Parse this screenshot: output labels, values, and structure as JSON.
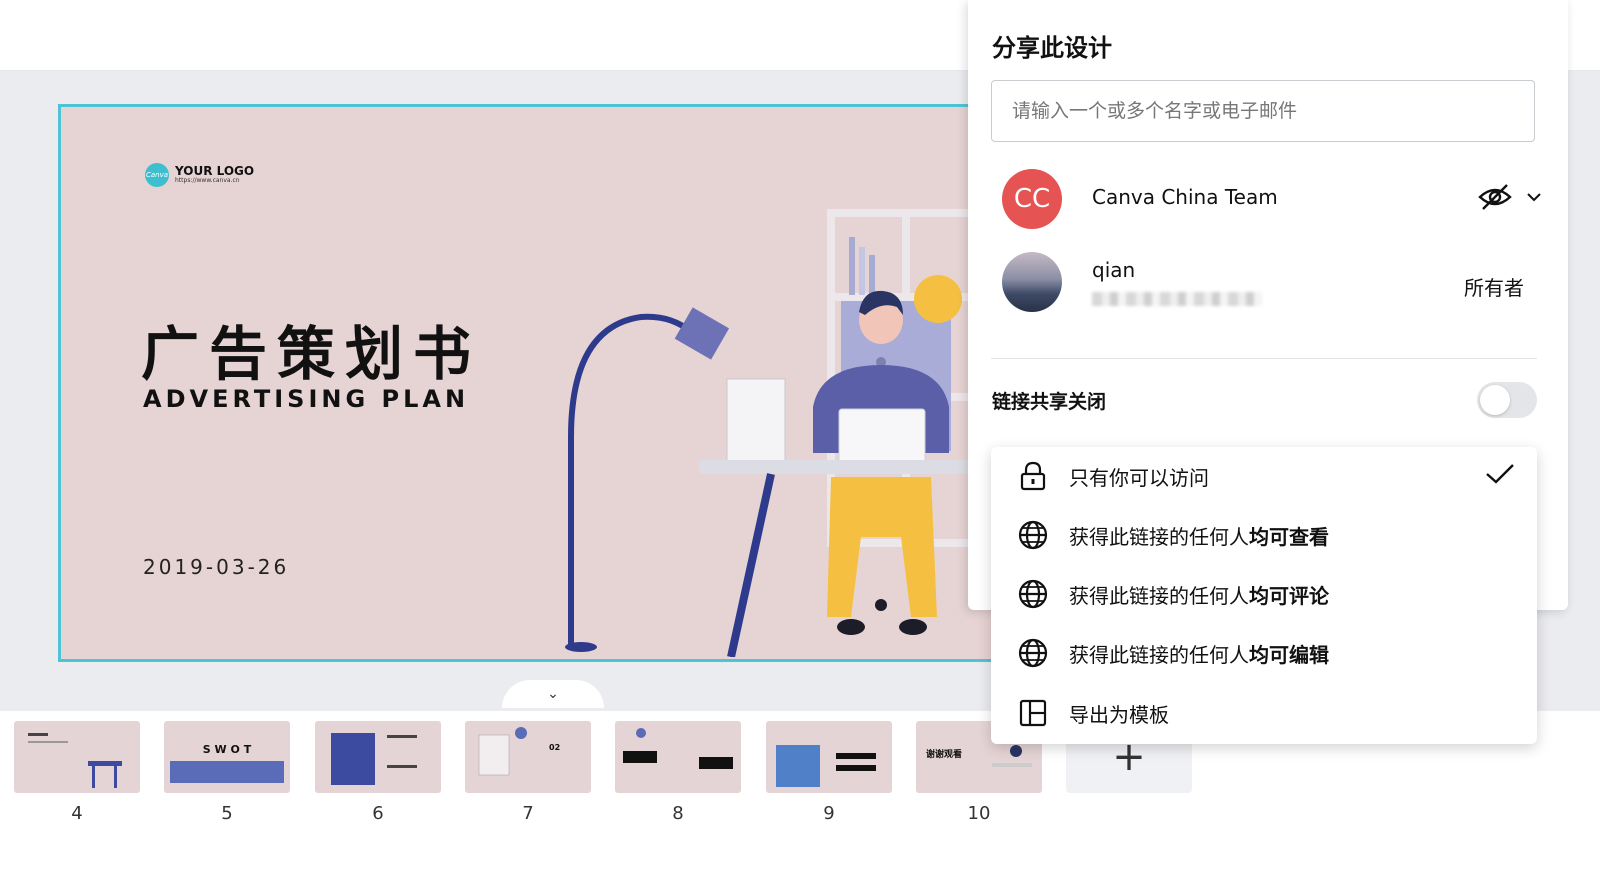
{
  "slide": {
    "logo_mark": "Canva",
    "logo_text": "YOUR LOGO",
    "logo_url": "https://www.canva.cn",
    "title_cn": "广告策划书",
    "title_en": "ADVERTISING PLAN",
    "date": "2019-03-26"
  },
  "filmstrip": {
    "thumbnails": [
      {
        "number": "4"
      },
      {
        "number": "5",
        "text": "S  W  O  T"
      },
      {
        "number": "6"
      },
      {
        "number": "7",
        "text": "02"
      },
      {
        "number": "8"
      },
      {
        "number": "9"
      },
      {
        "number": "10",
        "text": "谢谢观看"
      }
    ],
    "add_label": "+"
  },
  "share": {
    "title": "分享此设计",
    "input_placeholder": "请输入一个或多个名字或电子邮件",
    "members": [
      {
        "initials": "CC",
        "name": "Canva China Team",
        "avatar_color": "#e55353"
      },
      {
        "name": "qian",
        "role": "所有者"
      }
    ],
    "link_sharing_label": "链接共享关闭",
    "link_sharing_on": false,
    "options": [
      {
        "icon": "lock-icon",
        "label": "只有你可以访问",
        "bold": "",
        "selected": true
      },
      {
        "icon": "globe-icon",
        "label": "获得此链接的任何人",
        "bold": "均可查看",
        "selected": false
      },
      {
        "icon": "globe-icon",
        "label": "获得此链接的任何人",
        "bold": "均可评论",
        "selected": false
      },
      {
        "icon": "globe-icon",
        "label": "获得此链接的任何人",
        "bold": "均可编辑",
        "selected": false
      },
      {
        "icon": "template-icon",
        "label": "导出为模板",
        "bold": "",
        "selected": false
      }
    ]
  },
  "colors": {
    "slide_bg": "#e6d3d3",
    "selection_outline": "#4fc3d6",
    "avatar_cc": "#e55353"
  }
}
